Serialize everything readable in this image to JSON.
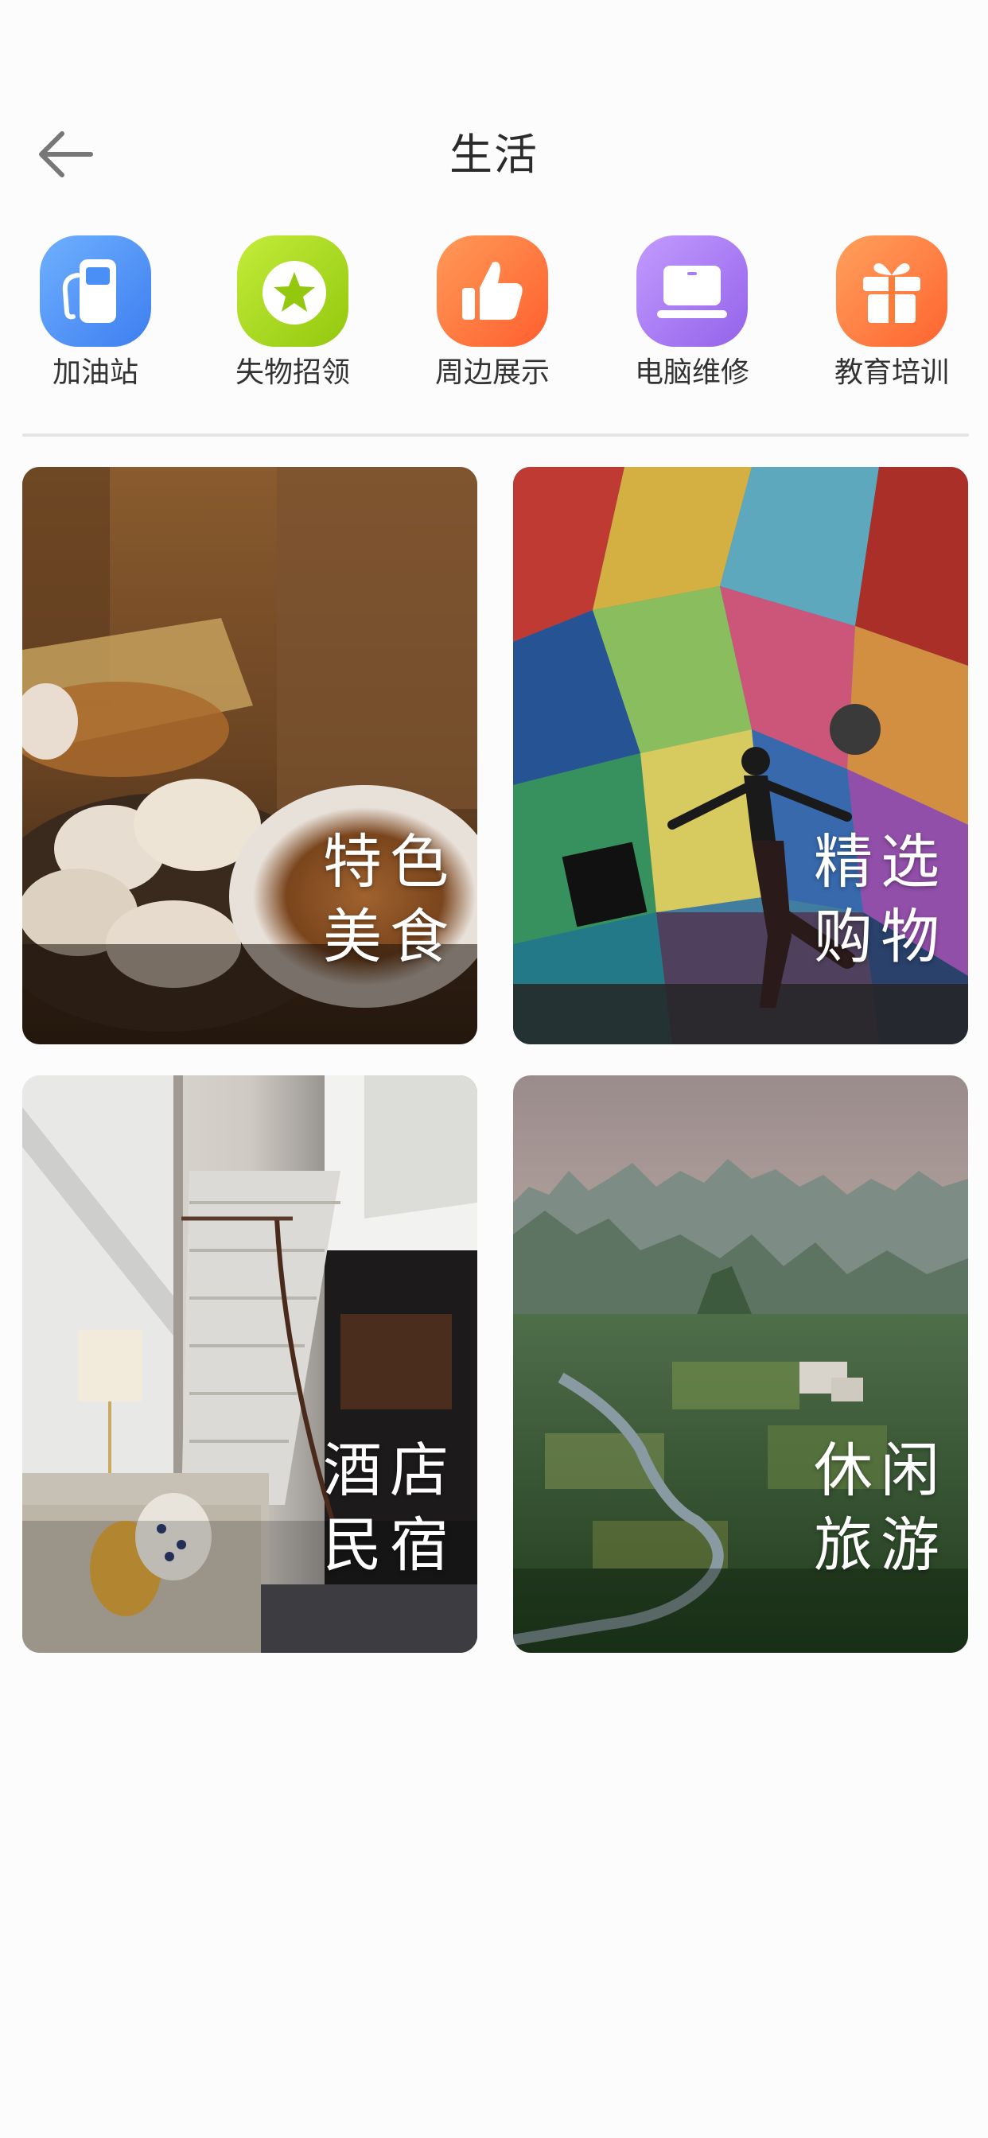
{
  "header": {
    "title": "生活",
    "back_icon": "arrow-left-icon"
  },
  "categories": [
    {
      "label": "加油站",
      "icon": "gas-station-icon",
      "color": "#4a8ff5"
    },
    {
      "label": "失物招领",
      "icon": "star-badge-icon",
      "color": "#a7d81d"
    },
    {
      "label": "周边展示",
      "icon": "thumbs-up-icon",
      "color": "#ff7a3d"
    },
    {
      "label": "电脑维修",
      "icon": "laptop-icon",
      "color": "#a77ef2"
    },
    {
      "label": "教育培训",
      "icon": "gift-icon",
      "color": "#ff7b3a"
    }
  ],
  "cards": [
    {
      "line1": "特色",
      "line2": "美食",
      "image": "dumplings-and-soup-photo"
    },
    {
      "line1": "精选",
      "line2": "购物",
      "image": "woman-with-shopping-bag-mural-photo"
    },
    {
      "line1": "酒店",
      "line2": "民宿",
      "image": "hotel-staircase-lounge-photo"
    },
    {
      "line1": "休闲",
      "line2": "旅游",
      "image": "karst-mountain-river-landscape-photo"
    }
  ]
}
